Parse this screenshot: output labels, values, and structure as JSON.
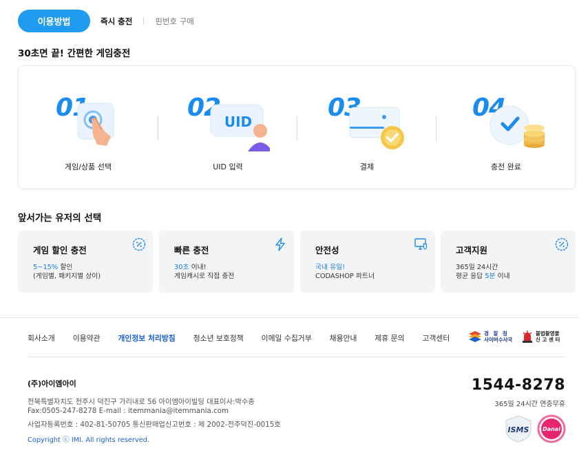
{
  "tabs": {
    "active": "이용방법",
    "instant": "즉시 충전",
    "pin": "핀번호 구매"
  },
  "steps_section": {
    "title": "30초면 끝! 간편한 게임충전",
    "steps": [
      {
        "num": "01",
        "label": "게임/상품 선택",
        "icon": "touch-hand-icon"
      },
      {
        "num": "02",
        "label": "UID 입력",
        "icon": "user-uid-icon",
        "badge": "UID"
      },
      {
        "num": "03",
        "label": "결제",
        "icon": "card-check-icon"
      },
      {
        "num": "04",
        "label": "충전 완료",
        "icon": "coin-check-icon"
      }
    ]
  },
  "features_section": {
    "title": "앞서가는 유저의 선택",
    "items": [
      {
        "title": "게임 할인 충전",
        "l1_blue": "5~15%",
        "l1_rest": " 할인",
        "l2_pre": "(게임별, 패키지별 상이)",
        "l2_blue": "",
        "l2_post": "",
        "icon": "discount-icon"
      },
      {
        "title": "빠른 충전",
        "l1_blue": "30초",
        "l1_rest": " 이내!",
        "l2_pre": "게임캐시로 직접 충전",
        "l2_blue": "",
        "l2_post": "",
        "icon": "lightning-icon"
      },
      {
        "title": "안전성",
        "l1_blue": "국내 유일!",
        "l1_rest": "",
        "l2_pre": "CODASHOP 파트너",
        "l2_blue": "",
        "l2_post": "",
        "icon": "secure-monitor-icon"
      },
      {
        "title": "고객지원",
        "l1_blue": "",
        "l1_rest": "365일 24시간",
        "l2_pre": "평균 응답 ",
        "l2_blue": "5분",
        "l2_post": " 이내",
        "icon": "discount-icon"
      }
    ]
  },
  "footer": {
    "nav": [
      "회사소개",
      "이용약관",
      "개인정보 처리방침",
      "청소년 보호정책",
      "이메일 수집거부",
      "채용안내",
      "제휴 문의",
      "고객센터"
    ],
    "badges": {
      "police_top": "경 찰 청",
      "police_bottom": "사이버수사국",
      "report_top": "불법촬영물",
      "report_bottom": "신 고 센 터"
    },
    "company": "(주)아이엠아이",
    "info1": "전북특별자치도 전주시 덕진구 가리내로 56 아이엠아이빌딩 대표이사:박수종",
    "info2": "Fax:0505-247-8278   E-mail : itemmania@itemmania.com",
    "info3": "사업자등록번호 : 402-81-50705   통신판매업신고번호 : 제 2002-전주덕진-0015호",
    "copyright": "Copyright ⓒ IMI. All rights reserved.",
    "phone": "1544-8278",
    "phone_sub": "365일 24시간 연중무휴",
    "isms": "ISMS",
    "danal": "Danal"
  },
  "colors": {
    "accent": "#1f9bf0",
    "feature_bg": "#f2f4f6",
    "link_blue": "#1a5fd0"
  }
}
